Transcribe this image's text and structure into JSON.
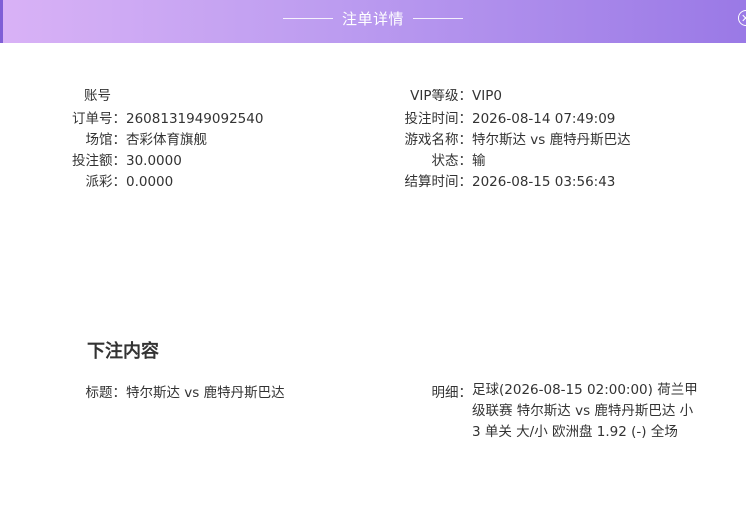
{
  "header": {
    "title": "注单详情",
    "close_icon": "close-icon"
  },
  "left_column": [
    {
      "label": "账号",
      "value": ""
    },
    {
      "label": "订单号：",
      "value": "2608131949092540"
    },
    {
      "label": "场馆：",
      "value": "杏彩体育旗舰"
    },
    {
      "label": "投注额：",
      "value": "30.0000"
    },
    {
      "label": "派彩：",
      "value": "0.0000"
    }
  ],
  "right_column": [
    {
      "label": "VIP等级：",
      "value": "VIP0"
    },
    {
      "label": "投注时间：",
      "value": "2026-08-14 07:49:09"
    },
    {
      "label": "游戏名称：",
      "value": "特尔斯达 vs 鹿特丹斯巴达"
    },
    {
      "label": "状态：",
      "value": "输"
    },
    {
      "label": "结算时间：",
      "value": "2026-08-15 03:56:43"
    }
  ],
  "bet_content": {
    "title": "下注内容",
    "subject_label": "标题：",
    "subject_value": "特尔斯达 vs 鹿特丹斯巴达",
    "detail_label": "明细：",
    "detail_value": "足球(2026-08-15 02:00:00) 荷兰甲级联赛 特尔斯达 vs 鹿特丹斯巴达 小 3 单关 大/小 欧洲盘 1.92 (-) 全场"
  }
}
